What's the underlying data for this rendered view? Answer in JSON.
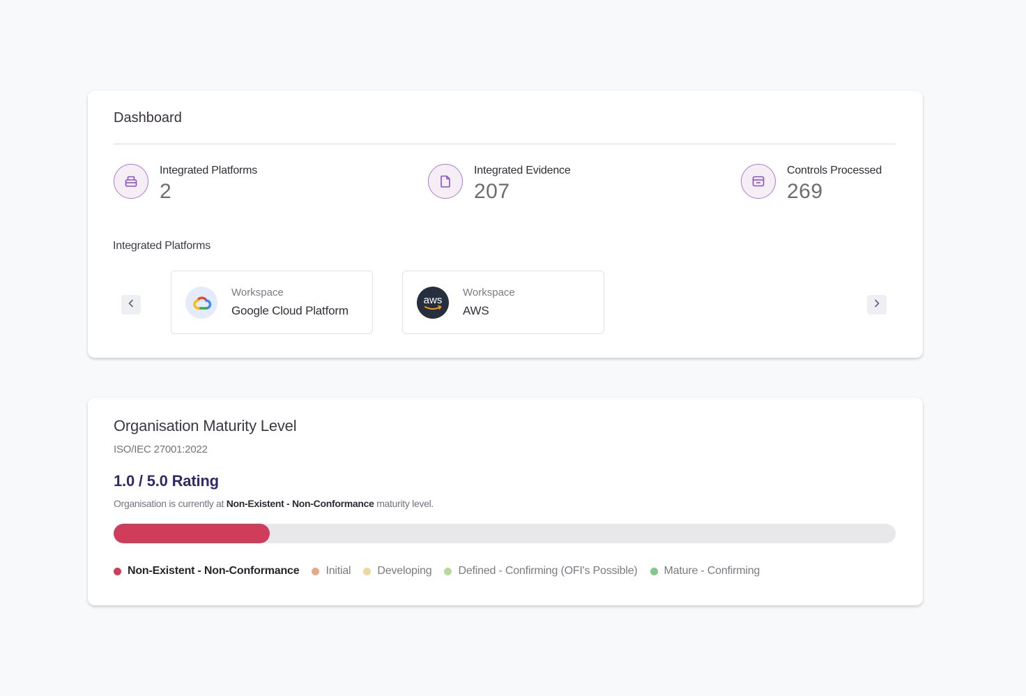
{
  "dashboard": {
    "title": "Dashboard",
    "stats": [
      {
        "label": "Integrated Platforms",
        "value": "2",
        "icon": "briefcase-icon"
      },
      {
        "label": "Integrated Evidence",
        "value": "207",
        "icon": "document-icon"
      },
      {
        "label": "Controls Processed",
        "value": "269",
        "icon": "window-icon"
      }
    ],
    "platforms_label": "Integrated Platforms",
    "platforms": [
      {
        "kind": "Workspace",
        "name": "Google Cloud Platform",
        "logo": "google-cloud-logo"
      },
      {
        "kind": "Workspace",
        "name": "AWS",
        "logo": "aws-logo",
        "logo_text": "aws"
      }
    ]
  },
  "maturity": {
    "title": "Organisation Maturity Level",
    "standard": "ISO/IEC 27001:2022",
    "rating": "1.0 / 5.0 Rating",
    "desc_prefix": "Organisation is currently at ",
    "desc_level": "Non-Existent - Non-Conformance",
    "desc_suffix": " maturity level.",
    "progress_fraction": 0.2,
    "progress_color": "#cf3d5b",
    "legend": [
      {
        "label": "Non-Existent - Non-Conformance",
        "color": "#cf3d5b",
        "active": true
      },
      {
        "label": "Initial",
        "color": "#e7a983",
        "active": false
      },
      {
        "label": "Developing",
        "color": "#f0d79d",
        "active": false
      },
      {
        "label": "Defined - Confirming (OFI's Possible)",
        "color": "#b7d99a",
        "active": false
      },
      {
        "label": "Mature - Confirming",
        "color": "#7fc98a",
        "active": false
      }
    ]
  }
}
